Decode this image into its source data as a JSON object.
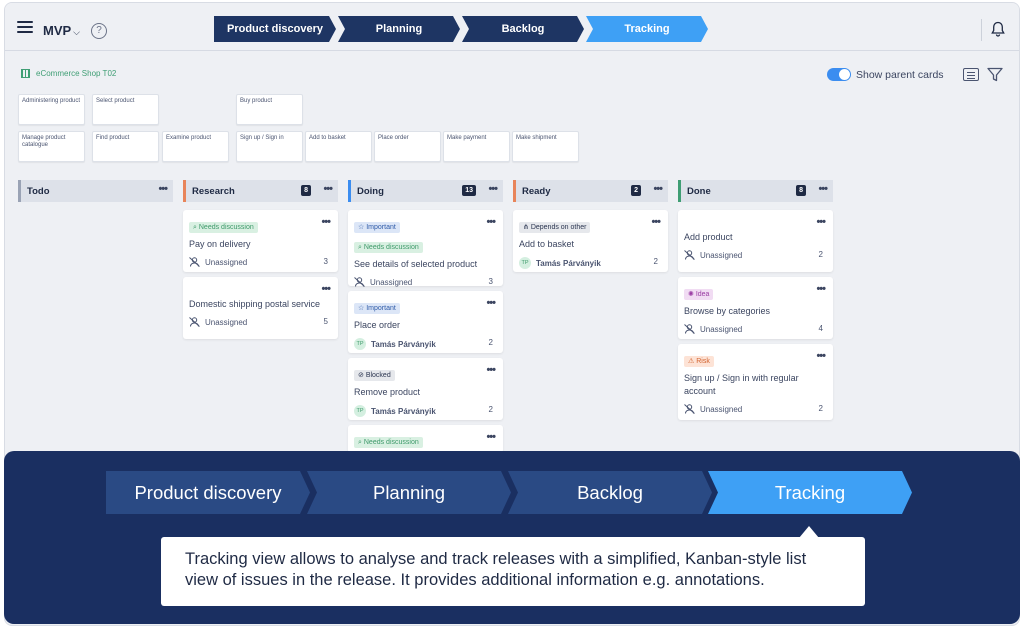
{
  "header": {
    "project": "MVP",
    "help": "?",
    "steps": [
      "Product discovery",
      "Planning",
      "Backlog",
      "Tracking"
    ],
    "active_step": "Tracking"
  },
  "toolbar": {
    "board_name": "eCommerce Shop T02",
    "show_parent_cards": "Show parent cards",
    "show_parent_cards_on": true
  },
  "story_map": {
    "row1": [
      "Administering product",
      "Select product",
      "Buy product"
    ],
    "row2": [
      "Manage product catalogue",
      "Find product",
      "Examine product",
      "Sign up / Sign in",
      "Add to basket",
      "Place order",
      "Make payment",
      "Make shipment"
    ]
  },
  "columns": [
    {
      "name": "Todo",
      "count": "",
      "color": "#9aa3b5"
    },
    {
      "name": "Research",
      "count": "8",
      "color": "#e8845a"
    },
    {
      "name": "Doing",
      "count": "13",
      "color": "#3b8df0"
    },
    {
      "name": "Ready",
      "count": "2",
      "color": "#e8845a"
    },
    {
      "name": "Done",
      "count": "8",
      "color": "#3f9e74"
    }
  ],
  "cards": {
    "research": [
      {
        "tag": "Needs discussion",
        "title": "Pay on delivery",
        "assignee": "Unassigned",
        "points": "3"
      },
      {
        "title": "Domestic shipping postal service",
        "assignee": "Unassigned",
        "points": "5"
      }
    ],
    "doing": [
      {
        "tags": [
          "Important",
          "Needs discussion"
        ],
        "title": "See details of selected product",
        "assignee": "Unassigned",
        "points": "3"
      },
      {
        "tag": "Important",
        "title": "Place order",
        "initials": "TP",
        "assignee": "Tamás Párványik",
        "points": "2"
      },
      {
        "tag": "Blocked",
        "title": "Remove product",
        "initials": "TP",
        "assignee": "Tamás Párványik",
        "points": "2"
      },
      {
        "tag": "Needs discussion"
      }
    ],
    "ready": [
      {
        "tag": "Depends on other",
        "title": "Add to basket",
        "initials": "TP",
        "assignee": "Tamás Párványik",
        "points": "2"
      }
    ],
    "done": [
      {
        "title": "Add product",
        "assignee": "Unassigned",
        "points": "2"
      },
      {
        "tag": "Idea",
        "title": "Browse by categories",
        "assignee": "Unassigned",
        "points": "4"
      },
      {
        "tag": "Risk",
        "title": "Sign up / Sign in with regular account",
        "assignee": "Unassigned",
        "points": "2"
      }
    ]
  },
  "callout": {
    "steps": [
      "Product discovery",
      "Planning",
      "Backlog",
      "Tracking"
    ],
    "text": "Tracking view allows to analyse and track releases with a simplified, Kanban-style list view of issues in the release. It provides additional information e.g. annotations."
  },
  "colors": {
    "navy": "#1e3563",
    "active": "#3ea0f5",
    "overlay": "#1a2f61"
  }
}
